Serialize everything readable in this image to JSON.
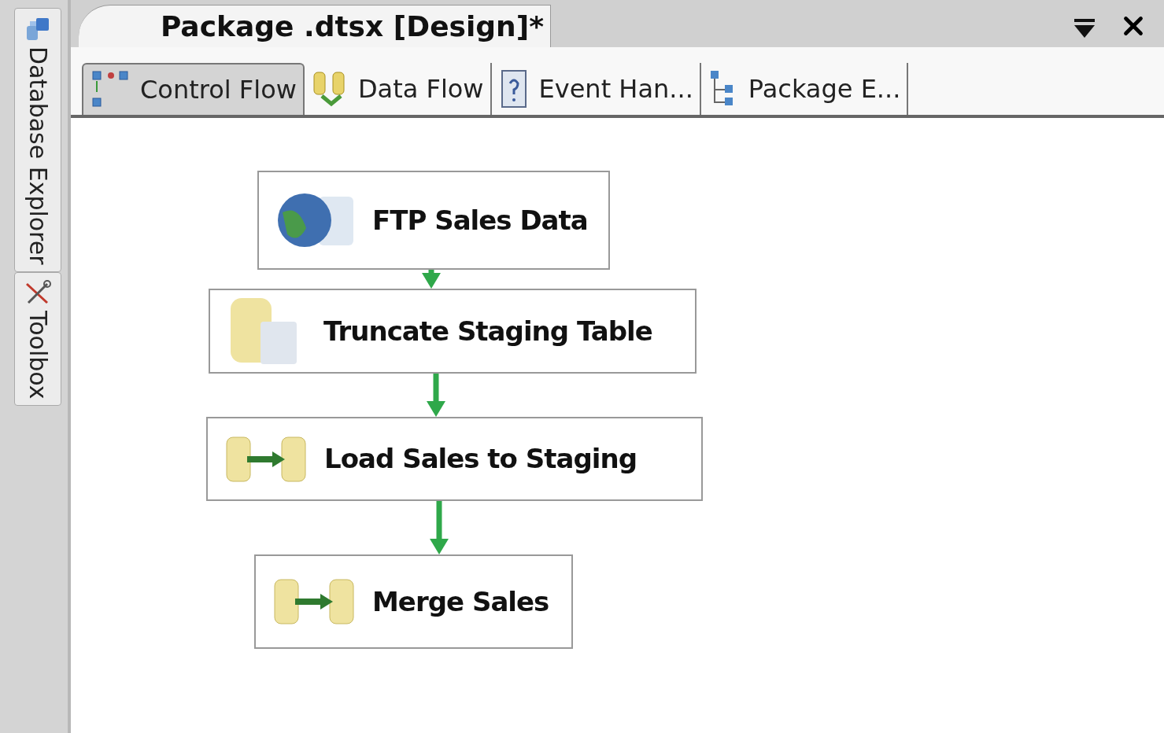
{
  "side_panel": {
    "tabs": [
      {
        "label": "Database Explorer",
        "kind": "database"
      },
      {
        "label": "Toolbox",
        "kind": "tools"
      }
    ]
  },
  "document_tab": {
    "title": "Package .dtsx [Design]*"
  },
  "designer_tabs": [
    {
      "label": "Control Flow",
      "kind": "control",
      "selected": true
    },
    {
      "label": "Data Flow",
      "kind": "data",
      "selected": false
    },
    {
      "label": "Event Han...",
      "kind": "event",
      "selected": false
    },
    {
      "label": "Package E...",
      "kind": "explorer",
      "selected": false
    }
  ],
  "tasks": [
    {
      "label": "FTP Sales Data",
      "kind": "ftp"
    },
    {
      "label": "Truncate Staging Table",
      "kind": "sql"
    },
    {
      "label": "Load Sales to Staging",
      "kind": "dataflow"
    },
    {
      "label": "Merge Sales",
      "kind": "dataflow"
    }
  ]
}
